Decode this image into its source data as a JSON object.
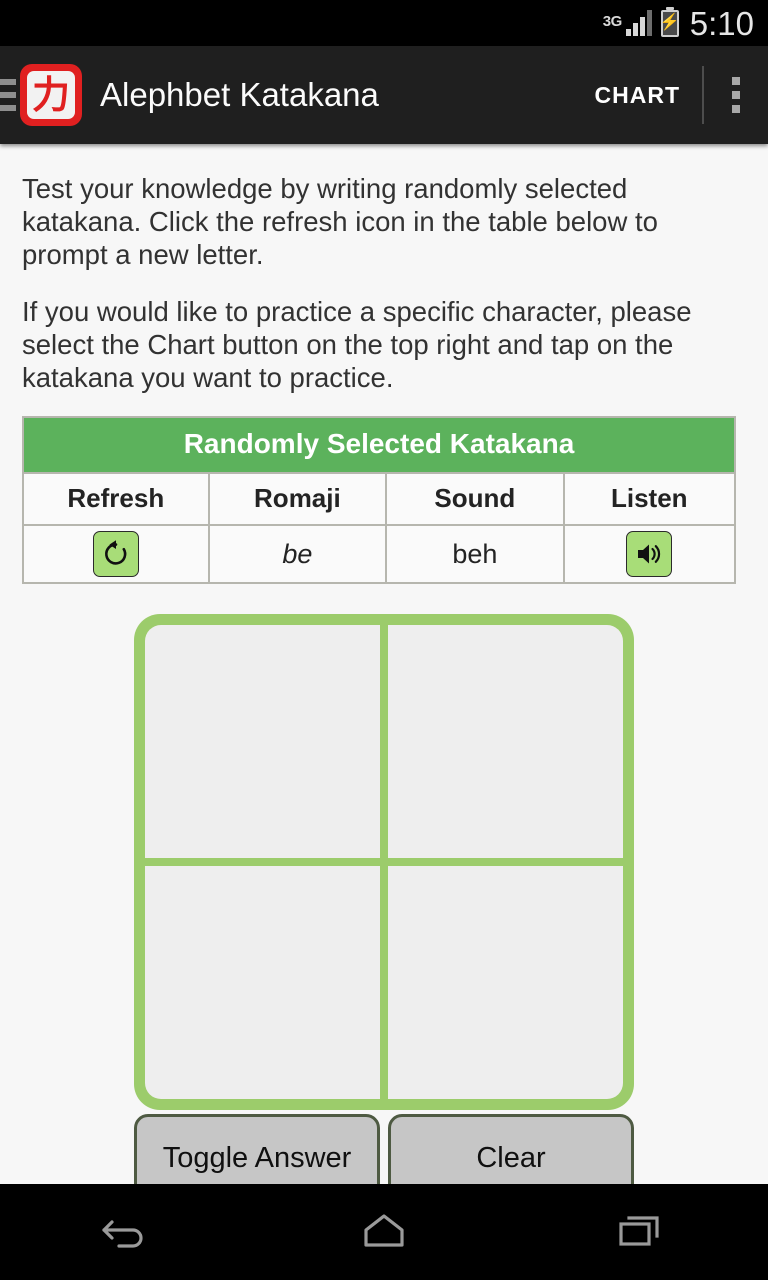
{
  "status_bar": {
    "network_label": "3G",
    "signal_icon": "signal-bars-icon",
    "battery_icon": "battery-charging-icon",
    "time": "5:10"
  },
  "action_bar": {
    "menu_icon": "hamburger-menu-icon",
    "app_icon_glyph": "力",
    "title": "Alephbet Katakana",
    "chart_label": "CHART",
    "overflow_icon": "overflow-menu-icon"
  },
  "instructions": {
    "paragraph_1": "Test your knowledge by writing randomly selected katakana.  Click the refresh icon in the table below to prompt a new letter.",
    "paragraph_2": "If you would like to practice a specific character, please select the Chart button on the top right and tap on the katakana you want to practice."
  },
  "table": {
    "title": "Randomly Selected Katakana",
    "headers": [
      "Refresh",
      "Romaji",
      "Sound",
      "Listen"
    ],
    "row": {
      "refresh_icon": "refresh-icon",
      "romaji": "be",
      "sound": "beh",
      "listen_icon": "speaker-icon"
    }
  },
  "canvas": {
    "quadrants": [
      "top-left",
      "top-right",
      "bottom-left",
      "bottom-right"
    ]
  },
  "buttons": {
    "toggle_answer": "Toggle Answer",
    "clear": "Clear"
  },
  "nav_bar": {
    "back_icon": "back-arrow-icon",
    "home_icon": "home-icon",
    "recents_icon": "recent-apps-icon"
  },
  "colors": {
    "accent_green": "#5cb25c",
    "canvas_green": "#9ccc6b",
    "icon_green": "#a8dd78",
    "action_bar": "#1f1f1f",
    "app_icon_red": "#e02020",
    "page_bg": "#f7f7f7"
  }
}
